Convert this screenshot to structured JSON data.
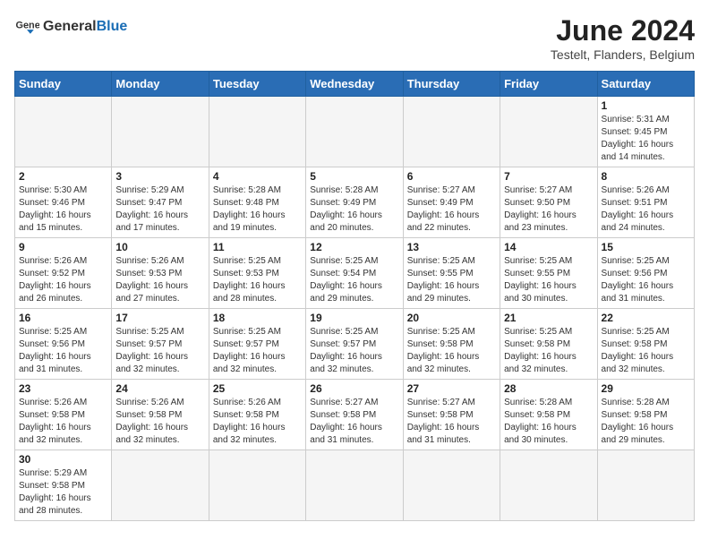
{
  "header": {
    "logo_text_normal": "General",
    "logo_text_bold": "Blue",
    "month_year": "June 2024",
    "location": "Testelt, Flanders, Belgium"
  },
  "days_of_week": [
    "Sunday",
    "Monday",
    "Tuesday",
    "Wednesday",
    "Thursday",
    "Friday",
    "Saturday"
  ],
  "weeks": [
    {
      "days": [
        {
          "number": "",
          "empty": true
        },
        {
          "number": "",
          "empty": true
        },
        {
          "number": "",
          "empty": true
        },
        {
          "number": "",
          "empty": true
        },
        {
          "number": "",
          "empty": true
        },
        {
          "number": "",
          "empty": true
        },
        {
          "number": "1",
          "sunrise": "Sunrise: 5:31 AM",
          "sunset": "Sunset: 9:45 PM",
          "daylight": "Daylight: 16 hours and 14 minutes."
        }
      ]
    },
    {
      "days": [
        {
          "number": "2",
          "sunrise": "Sunrise: 5:30 AM",
          "sunset": "Sunset: 9:46 PM",
          "daylight": "Daylight: 16 hours and 15 minutes."
        },
        {
          "number": "3",
          "sunrise": "Sunrise: 5:29 AM",
          "sunset": "Sunset: 9:47 PM",
          "daylight": "Daylight: 16 hours and 17 minutes."
        },
        {
          "number": "4",
          "sunrise": "Sunrise: 5:28 AM",
          "sunset": "Sunset: 9:48 PM",
          "daylight": "Daylight: 16 hours and 19 minutes."
        },
        {
          "number": "5",
          "sunrise": "Sunrise: 5:28 AM",
          "sunset": "Sunset: 9:49 PM",
          "daylight": "Daylight: 16 hours and 20 minutes."
        },
        {
          "number": "6",
          "sunrise": "Sunrise: 5:27 AM",
          "sunset": "Sunset: 9:49 PM",
          "daylight": "Daylight: 16 hours and 22 minutes."
        },
        {
          "number": "7",
          "sunrise": "Sunrise: 5:27 AM",
          "sunset": "Sunset: 9:50 PM",
          "daylight": "Daylight: 16 hours and 23 minutes."
        },
        {
          "number": "8",
          "sunrise": "Sunrise: 5:26 AM",
          "sunset": "Sunset: 9:51 PM",
          "daylight": "Daylight: 16 hours and 24 minutes."
        }
      ]
    },
    {
      "days": [
        {
          "number": "9",
          "sunrise": "Sunrise: 5:26 AM",
          "sunset": "Sunset: 9:52 PM",
          "daylight": "Daylight: 16 hours and 26 minutes."
        },
        {
          "number": "10",
          "sunrise": "Sunrise: 5:26 AM",
          "sunset": "Sunset: 9:53 PM",
          "daylight": "Daylight: 16 hours and 27 minutes."
        },
        {
          "number": "11",
          "sunrise": "Sunrise: 5:25 AM",
          "sunset": "Sunset: 9:53 PM",
          "daylight": "Daylight: 16 hours and 28 minutes."
        },
        {
          "number": "12",
          "sunrise": "Sunrise: 5:25 AM",
          "sunset": "Sunset: 9:54 PM",
          "daylight": "Daylight: 16 hours and 29 minutes."
        },
        {
          "number": "13",
          "sunrise": "Sunrise: 5:25 AM",
          "sunset": "Sunset: 9:55 PM",
          "daylight": "Daylight: 16 hours and 29 minutes."
        },
        {
          "number": "14",
          "sunrise": "Sunrise: 5:25 AM",
          "sunset": "Sunset: 9:55 PM",
          "daylight": "Daylight: 16 hours and 30 minutes."
        },
        {
          "number": "15",
          "sunrise": "Sunrise: 5:25 AM",
          "sunset": "Sunset: 9:56 PM",
          "daylight": "Daylight: 16 hours and 31 minutes."
        }
      ]
    },
    {
      "days": [
        {
          "number": "16",
          "sunrise": "Sunrise: 5:25 AM",
          "sunset": "Sunset: 9:56 PM",
          "daylight": "Daylight: 16 hours and 31 minutes."
        },
        {
          "number": "17",
          "sunrise": "Sunrise: 5:25 AM",
          "sunset": "Sunset: 9:57 PM",
          "daylight": "Daylight: 16 hours and 32 minutes."
        },
        {
          "number": "18",
          "sunrise": "Sunrise: 5:25 AM",
          "sunset": "Sunset: 9:57 PM",
          "daylight": "Daylight: 16 hours and 32 minutes."
        },
        {
          "number": "19",
          "sunrise": "Sunrise: 5:25 AM",
          "sunset": "Sunset: 9:57 PM",
          "daylight": "Daylight: 16 hours and 32 minutes."
        },
        {
          "number": "20",
          "sunrise": "Sunrise: 5:25 AM",
          "sunset": "Sunset: 9:58 PM",
          "daylight": "Daylight: 16 hours and 32 minutes."
        },
        {
          "number": "21",
          "sunrise": "Sunrise: 5:25 AM",
          "sunset": "Sunset: 9:58 PM",
          "daylight": "Daylight: 16 hours and 32 minutes."
        },
        {
          "number": "22",
          "sunrise": "Sunrise: 5:25 AM",
          "sunset": "Sunset: 9:58 PM",
          "daylight": "Daylight: 16 hours and 32 minutes."
        }
      ]
    },
    {
      "days": [
        {
          "number": "23",
          "sunrise": "Sunrise: 5:26 AM",
          "sunset": "Sunset: 9:58 PM",
          "daylight": "Daylight: 16 hours and 32 minutes."
        },
        {
          "number": "24",
          "sunrise": "Sunrise: 5:26 AM",
          "sunset": "Sunset: 9:58 PM",
          "daylight": "Daylight: 16 hours and 32 minutes."
        },
        {
          "number": "25",
          "sunrise": "Sunrise: 5:26 AM",
          "sunset": "Sunset: 9:58 PM",
          "daylight": "Daylight: 16 hours and 32 minutes."
        },
        {
          "number": "26",
          "sunrise": "Sunrise: 5:27 AM",
          "sunset": "Sunset: 9:58 PM",
          "daylight": "Daylight: 16 hours and 31 minutes."
        },
        {
          "number": "27",
          "sunrise": "Sunrise: 5:27 AM",
          "sunset": "Sunset: 9:58 PM",
          "daylight": "Daylight: 16 hours and 31 minutes."
        },
        {
          "number": "28",
          "sunrise": "Sunrise: 5:28 AM",
          "sunset": "Sunset: 9:58 PM",
          "daylight": "Daylight: 16 hours and 30 minutes."
        },
        {
          "number": "29",
          "sunrise": "Sunrise: 5:28 AM",
          "sunset": "Sunset: 9:58 PM",
          "daylight": "Daylight: 16 hours and 29 minutes."
        }
      ]
    },
    {
      "days": [
        {
          "number": "30",
          "sunrise": "Sunrise: 5:29 AM",
          "sunset": "Sunset: 9:58 PM",
          "daylight": "Daylight: 16 hours and 28 minutes."
        },
        {
          "number": "",
          "empty": true
        },
        {
          "number": "",
          "empty": true
        },
        {
          "number": "",
          "empty": true
        },
        {
          "number": "",
          "empty": true
        },
        {
          "number": "",
          "empty": true
        },
        {
          "number": "",
          "empty": true
        }
      ]
    }
  ]
}
